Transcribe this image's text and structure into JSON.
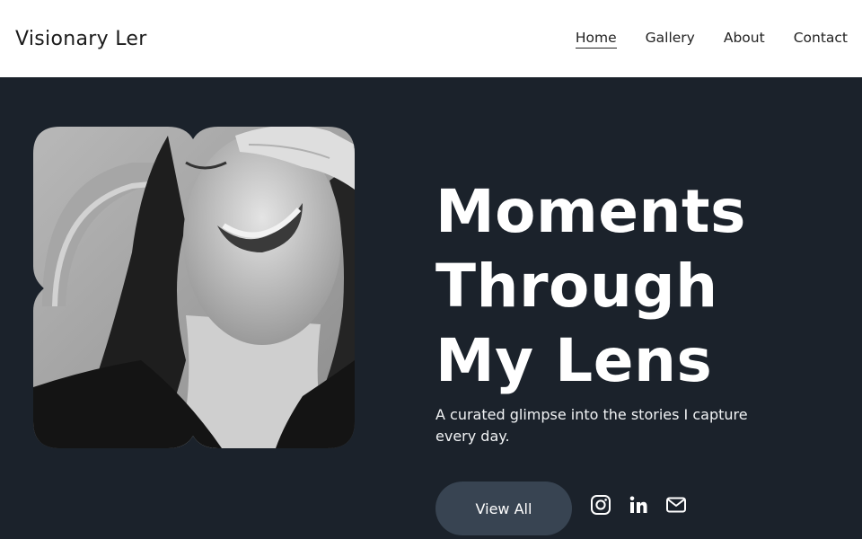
{
  "brand": {
    "name": "Visionary Ler"
  },
  "nav": {
    "items": [
      {
        "label": "Home",
        "active": true
      },
      {
        "label": "Gallery",
        "active": false
      },
      {
        "label": "About",
        "active": false
      },
      {
        "label": "Contact",
        "active": false
      }
    ]
  },
  "hero": {
    "headline": [
      "Moments",
      "Through",
      "My Lens"
    ],
    "subtitle": "A curated glimpse into the stories I capture every day.",
    "cta_label": "View All",
    "photo_alt": "Black and white portrait of a laughing woman with a hand on her forehead"
  },
  "socials": [
    {
      "icon": "instagram-icon"
    },
    {
      "icon": "linkedin-icon"
    },
    {
      "icon": "mail-icon"
    }
  ],
  "colors": {
    "header_bg": "#ffffff",
    "hero_bg": "#1b222b",
    "button_bg": "#384452",
    "text_light": "#ffffff"
  }
}
